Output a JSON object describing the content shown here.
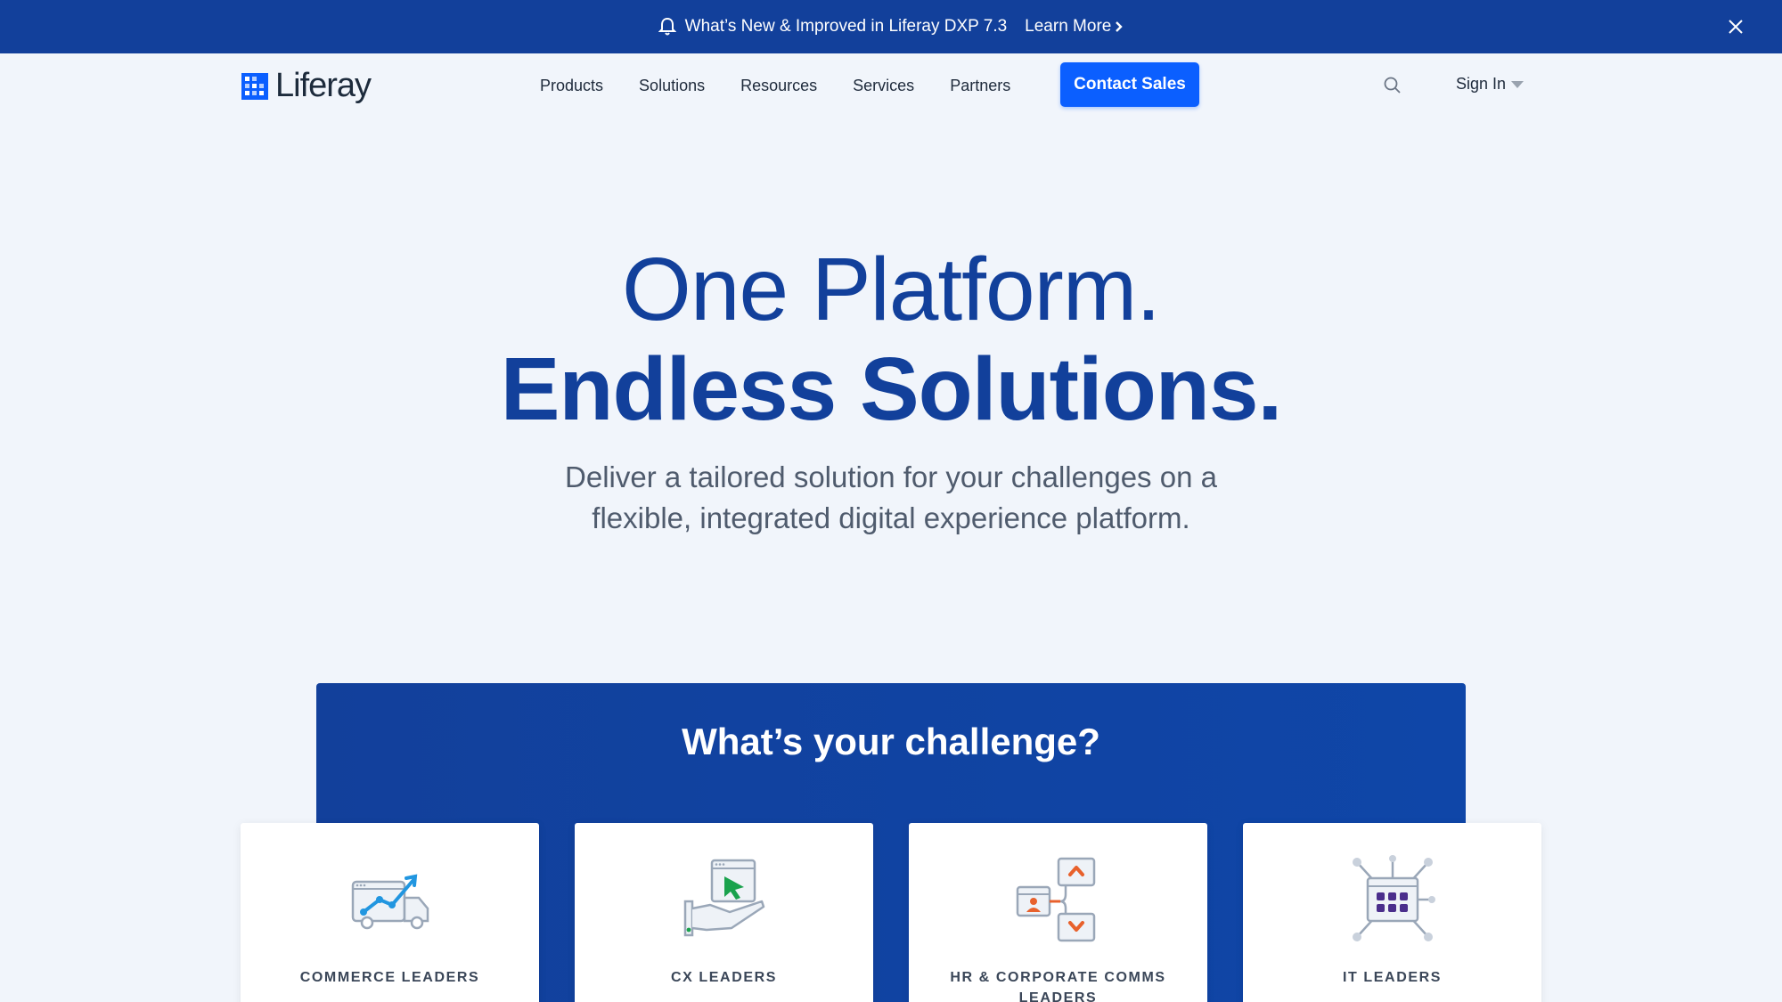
{
  "announcement": {
    "text": "What’s New & Improved in Liferay DXP 7.3",
    "link": "Learn More"
  },
  "header": {
    "logo_text": "Liferay",
    "nav": [
      "Products",
      "Solutions",
      "Resources",
      "Services",
      "Partners"
    ],
    "cta": "Contact Sales",
    "signin": "Sign In"
  },
  "hero": {
    "line1": "One Platform.",
    "line2": "Endless Solutions.",
    "subtitle": "Deliver a tailored solution for your challenges on a flexible, integrated digital experience platform."
  },
  "challenge": {
    "title": "What’s your challenge?",
    "cards": [
      {
        "label": "COMMERCE LEADERS",
        "icon": "truck-growth-icon"
      },
      {
        "label": "CX LEADERS",
        "icon": "hand-cursor-icon"
      },
      {
        "label": "HR & CORPORATE COMMS LEADERS",
        "icon": "people-flow-icon"
      },
      {
        "label": "IT LEADERS",
        "icon": "network-grid-icon"
      }
    ]
  },
  "colors": {
    "brand_blue": "#12409b",
    "cta_blue": "#0b5fff",
    "page_bg": "#f1f5fb"
  }
}
